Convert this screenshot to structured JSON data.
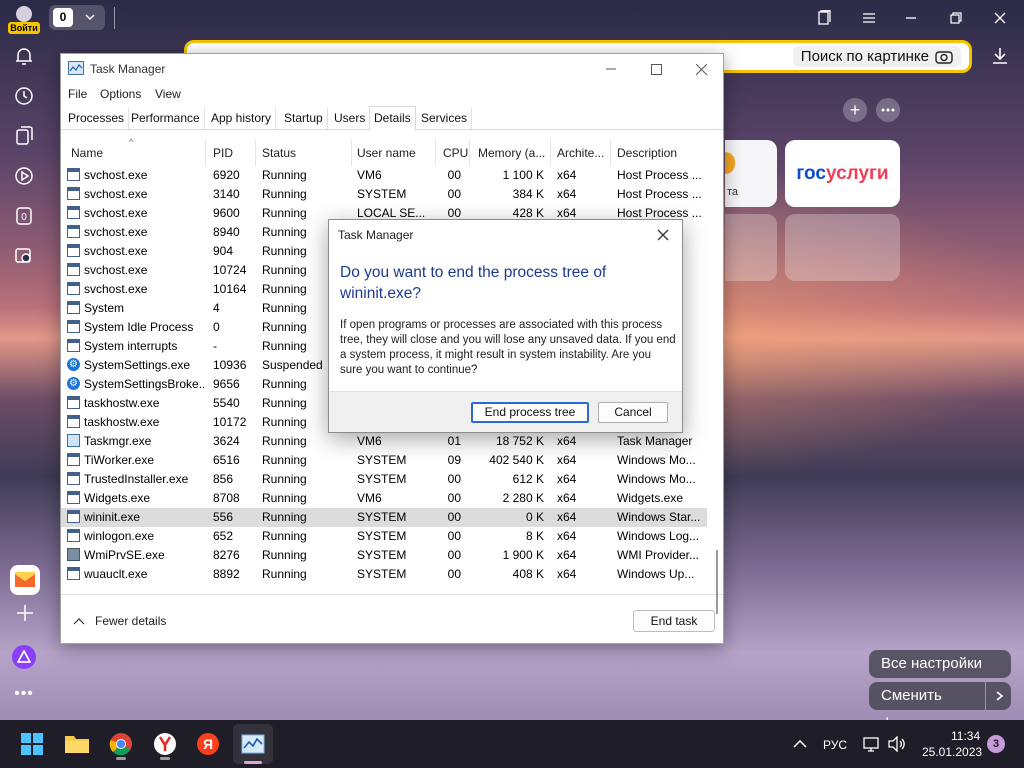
{
  "browser": {
    "login_label": "Войти",
    "tab_count": "0",
    "image_search_label": "Поиск по картинке",
    "tile_gos_part1": "гос",
    "tile_gos_part2": "услуги",
    "tile_partial_text": "та",
    "all_settings_label": "Все настройки",
    "change_bg_label": "Сменить фон"
  },
  "taskmgr": {
    "title": "Task Manager",
    "menu": [
      "File",
      "Options",
      "View"
    ],
    "tabs": [
      "Processes",
      "Performance",
      "App history",
      "Startup",
      "Users",
      "Details",
      "Services"
    ],
    "active_tab": "Details",
    "columns": [
      "Name",
      "PID",
      "Status",
      "User name",
      "CPU",
      "Memory (a...",
      "Archite...",
      "Description"
    ],
    "rows": [
      {
        "name": "svchost.exe",
        "pid": "6920",
        "status": "Running",
        "user": "VM6",
        "cpu": "00",
        "mem": "1 100 K",
        "arch": "x64",
        "desc": "Host Process ...",
        "icon": "generic"
      },
      {
        "name": "svchost.exe",
        "pid": "3140",
        "status": "Running",
        "user": "SYSTEM",
        "cpu": "00",
        "mem": "384 K",
        "arch": "x64",
        "desc": "Host Process ...",
        "icon": "generic"
      },
      {
        "name": "svchost.exe",
        "pid": "9600",
        "status": "Running",
        "user": "LOCAL SE...",
        "cpu": "00",
        "mem": "428 K",
        "arch": "x64",
        "desc": "Host Process ...",
        "icon": "generic"
      },
      {
        "name": "svchost.exe",
        "pid": "8940",
        "status": "Running",
        "user": "",
        "cpu": "",
        "mem": "",
        "arch": "",
        "desc": "s ...",
        "icon": "generic"
      },
      {
        "name": "svchost.exe",
        "pid": "904",
        "status": "Running",
        "user": "",
        "cpu": "",
        "mem": "",
        "arch": "",
        "desc": "s ...",
        "icon": "generic"
      },
      {
        "name": "svchost.exe",
        "pid": "10724",
        "status": "Running",
        "user": "",
        "cpu": "",
        "mem": "",
        "arch": "",
        "desc": "s ...",
        "icon": "generic"
      },
      {
        "name": "svchost.exe",
        "pid": "10164",
        "status": "Running",
        "user": "",
        "cpu": "",
        "mem": "",
        "arch": "",
        "desc": "s ...",
        "icon": "generic"
      },
      {
        "name": "System",
        "pid": "4",
        "status": "Running",
        "user": "",
        "cpu": "",
        "mem": "",
        "arch": "",
        "desc": "t S...",
        "icon": "generic"
      },
      {
        "name": "System Idle Process",
        "pid": "0",
        "status": "Running",
        "user": "",
        "cpu": "",
        "mem": "",
        "arch": "",
        "desc": "of...",
        "icon": "generic"
      },
      {
        "name": "System interrupts",
        "pid": "-",
        "status": "Running",
        "user": "",
        "cpu": "",
        "mem": "",
        "arch": "",
        "desc": "oc...",
        "icon": "generic"
      },
      {
        "name": "SystemSettings.exe",
        "pid": "10936",
        "status": "Suspended",
        "user": "",
        "cpu": "",
        "mem": "",
        "arch": "",
        "desc": "",
        "icon": "gear"
      },
      {
        "name": "SystemSettingsBroke...",
        "pid": "9656",
        "status": "Running",
        "user": "",
        "cpu": "",
        "mem": "",
        "arch": "",
        "desc": "in...",
        "icon": "gear"
      },
      {
        "name": "taskhostw.exe",
        "pid": "5540",
        "status": "Running",
        "user": "",
        "cpu": "",
        "mem": "",
        "arch": "",
        "desc": "s ...",
        "icon": "generic"
      },
      {
        "name": "taskhostw.exe",
        "pid": "10172",
        "status": "Running",
        "user": "",
        "cpu": "",
        "mem": "",
        "arch": "",
        "desc": "s ...",
        "icon": "generic"
      },
      {
        "name": "Taskmgr.exe",
        "pid": "3624",
        "status": "Running",
        "user": "VM6",
        "cpu": "01",
        "mem": "18 752 K",
        "arch": "x64",
        "desc": "Task Manager",
        "icon": "tm"
      },
      {
        "name": "TiWorker.exe",
        "pid": "6516",
        "status": "Running",
        "user": "SYSTEM",
        "cpu": "09",
        "mem": "402 540 K",
        "arch": "x64",
        "desc": "Windows Mo...",
        "icon": "generic"
      },
      {
        "name": "TrustedInstaller.exe",
        "pid": "856",
        "status": "Running",
        "user": "SYSTEM",
        "cpu": "00",
        "mem": "612 K",
        "arch": "x64",
        "desc": "Windows Mo...",
        "icon": "generic"
      },
      {
        "name": "Widgets.exe",
        "pid": "8708",
        "status": "Running",
        "user": "VM6",
        "cpu": "00",
        "mem": "2 280 K",
        "arch": "x64",
        "desc": "Widgets.exe",
        "icon": "generic"
      },
      {
        "name": "wininit.exe",
        "pid": "556",
        "status": "Running",
        "user": "SYSTEM",
        "cpu": "00",
        "mem": "0 K",
        "arch": "x64",
        "desc": "Windows Star...",
        "icon": "generic",
        "selected": true
      },
      {
        "name": "winlogon.exe",
        "pid": "652",
        "status": "Running",
        "user": "SYSTEM",
        "cpu": "00",
        "mem": "8 K",
        "arch": "x64",
        "desc": "Windows Log...",
        "icon": "generic"
      },
      {
        "name": "WmiPrvSE.exe",
        "pid": "8276",
        "status": "Running",
        "user": "SYSTEM",
        "cpu": "00",
        "mem": "1 900 K",
        "arch": "x64",
        "desc": "WMI Provider...",
        "icon": "wmi"
      },
      {
        "name": "wuauclt.exe",
        "pid": "8892",
        "status": "Running",
        "user": "SYSTEM",
        "cpu": "00",
        "mem": "408 K",
        "arch": "x64",
        "desc": "Windows Up...",
        "icon": "generic"
      }
    ],
    "fewer_details_label": "Fewer details",
    "end_task_label": "End task"
  },
  "dialog": {
    "title": "Task Manager",
    "heading": "Do you want to end the process tree of wininit.exe?",
    "body": "If open programs or processes are associated with this process tree, they will close and you will lose any unsaved data. If you end a system process, it might result in system instability. Are you sure you want to continue?",
    "confirm_label": "End process tree",
    "cancel_label": "Cancel"
  },
  "taskbar": {
    "language": "РУС",
    "time": "11:34",
    "date": "25.01.2023",
    "notification_count": "3"
  }
}
